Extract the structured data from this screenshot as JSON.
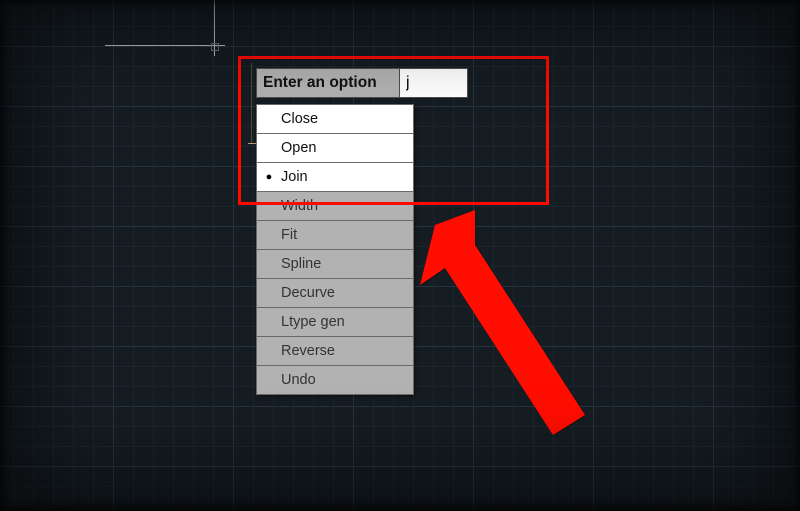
{
  "prompt": {
    "label": "Enter an option",
    "value": "j"
  },
  "options": [
    {
      "label": "Close",
      "matches": true,
      "selected": false
    },
    {
      "label": "Open",
      "matches": true,
      "selected": false
    },
    {
      "label": "Join",
      "matches": true,
      "selected": true
    },
    {
      "label": "Width",
      "matches": false,
      "selected": false
    },
    {
      "label": "Fit",
      "matches": false,
      "selected": false
    },
    {
      "label": "Spline",
      "matches": false,
      "selected": false
    },
    {
      "label": "Decurve",
      "matches": false,
      "selected": false
    },
    {
      "label": "Ltype gen",
      "matches": false,
      "selected": false
    },
    {
      "label": "Reverse",
      "matches": false,
      "selected": false
    },
    {
      "label": "Undo",
      "matches": false,
      "selected": false
    }
  ],
  "annotation": {
    "color": "#ff0a00"
  }
}
